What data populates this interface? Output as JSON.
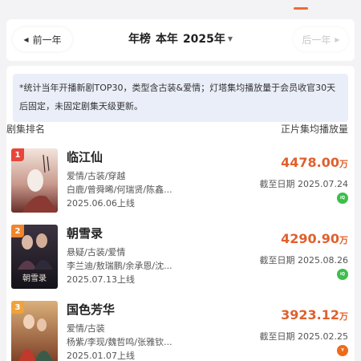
{
  "nav": {
    "prev_label": "前一年",
    "next_label": "后一年",
    "title_main": "年榜",
    "title_sub": "本年",
    "year": "2025年"
  },
  "note": "*统计当年开播新剧TOP30，类型含古装&爱情；灯塔集均播放量于会员收官30天后固定，未固定剧集天级更新。",
  "headers": {
    "left": "剧集排名",
    "right": "正片集均播放量"
  },
  "colors": {
    "accent": "#e0602c",
    "rank1": "#e8463a",
    "rank2": "#f0852c",
    "rank3": "#f0a33a",
    "platform_iqiyi": "#3bbf4a",
    "platform_youku": "#ef6a1a"
  },
  "shows": [
    {
      "rank": "1",
      "name": "临江仙",
      "genre": "爱情/古装/穿越",
      "cast": "白鹿/曾舜晞/何瑞贤/陈鑫...",
      "release": "2025.06.06上线",
      "value": "4478.00",
      "unit": "万",
      "cutoff": "截至日期 2025.07.24",
      "platform_icon": "iqiyi-icon"
    },
    {
      "rank": "2",
      "name": "朝雪录",
      "genre": "悬疑/古装/爱情",
      "cast": "李兰迪/敖瑞鹏/余承恩/沈...",
      "release": "2025.07.13上线",
      "value": "4290.90",
      "unit": "万",
      "cutoff": "截至日期 2025.08.26",
      "platform_icon": "iqiyi-icon"
    },
    {
      "rank": "3",
      "name": "国色芳华",
      "genre": "爱情/古装",
      "cast": "杨紫/李现/魏哲鸣/张雅钦...",
      "release": "2025.01.07上线",
      "value": "3923.12",
      "unit": "万",
      "cutoff": "截至日期 2025.02.25",
      "platform_icon": "youku-icon"
    }
  ]
}
